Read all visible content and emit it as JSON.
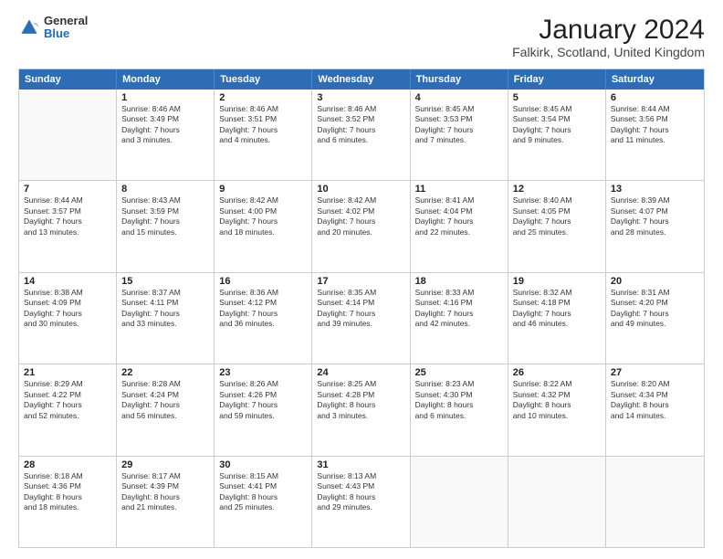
{
  "header": {
    "logo_general": "General",
    "logo_blue": "Blue",
    "month_title": "January 2024",
    "subtitle": "Falkirk, Scotland, United Kingdom"
  },
  "weekdays": [
    "Sunday",
    "Monday",
    "Tuesday",
    "Wednesday",
    "Thursday",
    "Friday",
    "Saturday"
  ],
  "rows": [
    [
      {
        "day": "",
        "lines": []
      },
      {
        "day": "1",
        "lines": [
          "Sunrise: 8:46 AM",
          "Sunset: 3:49 PM",
          "Daylight: 7 hours",
          "and 3 minutes."
        ]
      },
      {
        "day": "2",
        "lines": [
          "Sunrise: 8:46 AM",
          "Sunset: 3:51 PM",
          "Daylight: 7 hours",
          "and 4 minutes."
        ]
      },
      {
        "day": "3",
        "lines": [
          "Sunrise: 8:46 AM",
          "Sunset: 3:52 PM",
          "Daylight: 7 hours",
          "and 6 minutes."
        ]
      },
      {
        "day": "4",
        "lines": [
          "Sunrise: 8:45 AM",
          "Sunset: 3:53 PM",
          "Daylight: 7 hours",
          "and 7 minutes."
        ]
      },
      {
        "day": "5",
        "lines": [
          "Sunrise: 8:45 AM",
          "Sunset: 3:54 PM",
          "Daylight: 7 hours",
          "and 9 minutes."
        ]
      },
      {
        "day": "6",
        "lines": [
          "Sunrise: 8:44 AM",
          "Sunset: 3:56 PM",
          "Daylight: 7 hours",
          "and 11 minutes."
        ]
      }
    ],
    [
      {
        "day": "7",
        "lines": [
          "Sunrise: 8:44 AM",
          "Sunset: 3:57 PM",
          "Daylight: 7 hours",
          "and 13 minutes."
        ]
      },
      {
        "day": "8",
        "lines": [
          "Sunrise: 8:43 AM",
          "Sunset: 3:59 PM",
          "Daylight: 7 hours",
          "and 15 minutes."
        ]
      },
      {
        "day": "9",
        "lines": [
          "Sunrise: 8:42 AM",
          "Sunset: 4:00 PM",
          "Daylight: 7 hours",
          "and 18 minutes."
        ]
      },
      {
        "day": "10",
        "lines": [
          "Sunrise: 8:42 AM",
          "Sunset: 4:02 PM",
          "Daylight: 7 hours",
          "and 20 minutes."
        ]
      },
      {
        "day": "11",
        "lines": [
          "Sunrise: 8:41 AM",
          "Sunset: 4:04 PM",
          "Daylight: 7 hours",
          "and 22 minutes."
        ]
      },
      {
        "day": "12",
        "lines": [
          "Sunrise: 8:40 AM",
          "Sunset: 4:05 PM",
          "Daylight: 7 hours",
          "and 25 minutes."
        ]
      },
      {
        "day": "13",
        "lines": [
          "Sunrise: 8:39 AM",
          "Sunset: 4:07 PM",
          "Daylight: 7 hours",
          "and 28 minutes."
        ]
      }
    ],
    [
      {
        "day": "14",
        "lines": [
          "Sunrise: 8:38 AM",
          "Sunset: 4:09 PM",
          "Daylight: 7 hours",
          "and 30 minutes."
        ]
      },
      {
        "day": "15",
        "lines": [
          "Sunrise: 8:37 AM",
          "Sunset: 4:11 PM",
          "Daylight: 7 hours",
          "and 33 minutes."
        ]
      },
      {
        "day": "16",
        "lines": [
          "Sunrise: 8:36 AM",
          "Sunset: 4:12 PM",
          "Daylight: 7 hours",
          "and 36 minutes."
        ]
      },
      {
        "day": "17",
        "lines": [
          "Sunrise: 8:35 AM",
          "Sunset: 4:14 PM",
          "Daylight: 7 hours",
          "and 39 minutes."
        ]
      },
      {
        "day": "18",
        "lines": [
          "Sunrise: 8:33 AM",
          "Sunset: 4:16 PM",
          "Daylight: 7 hours",
          "and 42 minutes."
        ]
      },
      {
        "day": "19",
        "lines": [
          "Sunrise: 8:32 AM",
          "Sunset: 4:18 PM",
          "Daylight: 7 hours",
          "and 46 minutes."
        ]
      },
      {
        "day": "20",
        "lines": [
          "Sunrise: 8:31 AM",
          "Sunset: 4:20 PM",
          "Daylight: 7 hours",
          "and 49 minutes."
        ]
      }
    ],
    [
      {
        "day": "21",
        "lines": [
          "Sunrise: 8:29 AM",
          "Sunset: 4:22 PM",
          "Daylight: 7 hours",
          "and 52 minutes."
        ]
      },
      {
        "day": "22",
        "lines": [
          "Sunrise: 8:28 AM",
          "Sunset: 4:24 PM",
          "Daylight: 7 hours",
          "and 56 minutes."
        ]
      },
      {
        "day": "23",
        "lines": [
          "Sunrise: 8:26 AM",
          "Sunset: 4:26 PM",
          "Daylight: 7 hours",
          "and 59 minutes."
        ]
      },
      {
        "day": "24",
        "lines": [
          "Sunrise: 8:25 AM",
          "Sunset: 4:28 PM",
          "Daylight: 8 hours",
          "and 3 minutes."
        ]
      },
      {
        "day": "25",
        "lines": [
          "Sunrise: 8:23 AM",
          "Sunset: 4:30 PM",
          "Daylight: 8 hours",
          "and 6 minutes."
        ]
      },
      {
        "day": "26",
        "lines": [
          "Sunrise: 8:22 AM",
          "Sunset: 4:32 PM",
          "Daylight: 8 hours",
          "and 10 minutes."
        ]
      },
      {
        "day": "27",
        "lines": [
          "Sunrise: 8:20 AM",
          "Sunset: 4:34 PM",
          "Daylight: 8 hours",
          "and 14 minutes."
        ]
      }
    ],
    [
      {
        "day": "28",
        "lines": [
          "Sunrise: 8:18 AM",
          "Sunset: 4:36 PM",
          "Daylight: 8 hours",
          "and 18 minutes."
        ]
      },
      {
        "day": "29",
        "lines": [
          "Sunrise: 8:17 AM",
          "Sunset: 4:39 PM",
          "Daylight: 8 hours",
          "and 21 minutes."
        ]
      },
      {
        "day": "30",
        "lines": [
          "Sunrise: 8:15 AM",
          "Sunset: 4:41 PM",
          "Daylight: 8 hours",
          "and 25 minutes."
        ]
      },
      {
        "day": "31",
        "lines": [
          "Sunrise: 8:13 AM",
          "Sunset: 4:43 PM",
          "Daylight: 8 hours",
          "and 29 minutes."
        ]
      },
      {
        "day": "",
        "lines": []
      },
      {
        "day": "",
        "lines": []
      },
      {
        "day": "",
        "lines": []
      }
    ]
  ]
}
